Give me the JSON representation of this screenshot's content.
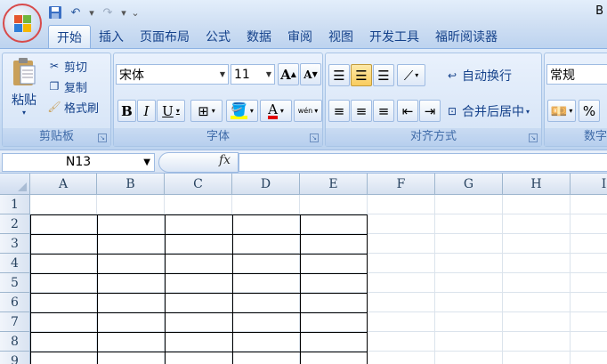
{
  "title_right": "B",
  "tabs": [
    {
      "label": "开始",
      "active": true
    },
    {
      "label": "插入"
    },
    {
      "label": "页面布局"
    },
    {
      "label": "公式"
    },
    {
      "label": "数据"
    },
    {
      "label": "审阅"
    },
    {
      "label": "视图"
    },
    {
      "label": "开发工具"
    },
    {
      "label": "福昕阅读器"
    }
  ],
  "clipboard": {
    "paste": "粘贴",
    "cut": "剪切",
    "copy": "复制",
    "format_painter": "格式刷",
    "label": "剪贴板"
  },
  "font": {
    "name": "宋体",
    "size": "11",
    "grow": "A",
    "shrink": "A",
    "bold": "B",
    "italic": "I",
    "underline": "U",
    "font_color_letter": "A",
    "wen": "wén",
    "label": "字体"
  },
  "alignment": {
    "wrap_text": "自动换行",
    "merge_center": "合并后居中",
    "label": "对齐方式"
  },
  "number": {
    "format": "常规",
    "percent": "%",
    "label": "数字"
  },
  "formula_bar": {
    "name_box": "N13",
    "fx": "fx"
  },
  "columns": [
    "A",
    "B",
    "C",
    "D",
    "E",
    "F",
    "G",
    "H",
    "I"
  ],
  "rows": [
    "1",
    "2",
    "3",
    "4",
    "5",
    "6",
    "7",
    "8",
    "9"
  ],
  "colors": {
    "accent": "#15428b",
    "ribbon": "#cfdff3",
    "office_ring": "#d84a4a",
    "highlight_yellow": "#ffff00",
    "font_red": "#e00000"
  }
}
